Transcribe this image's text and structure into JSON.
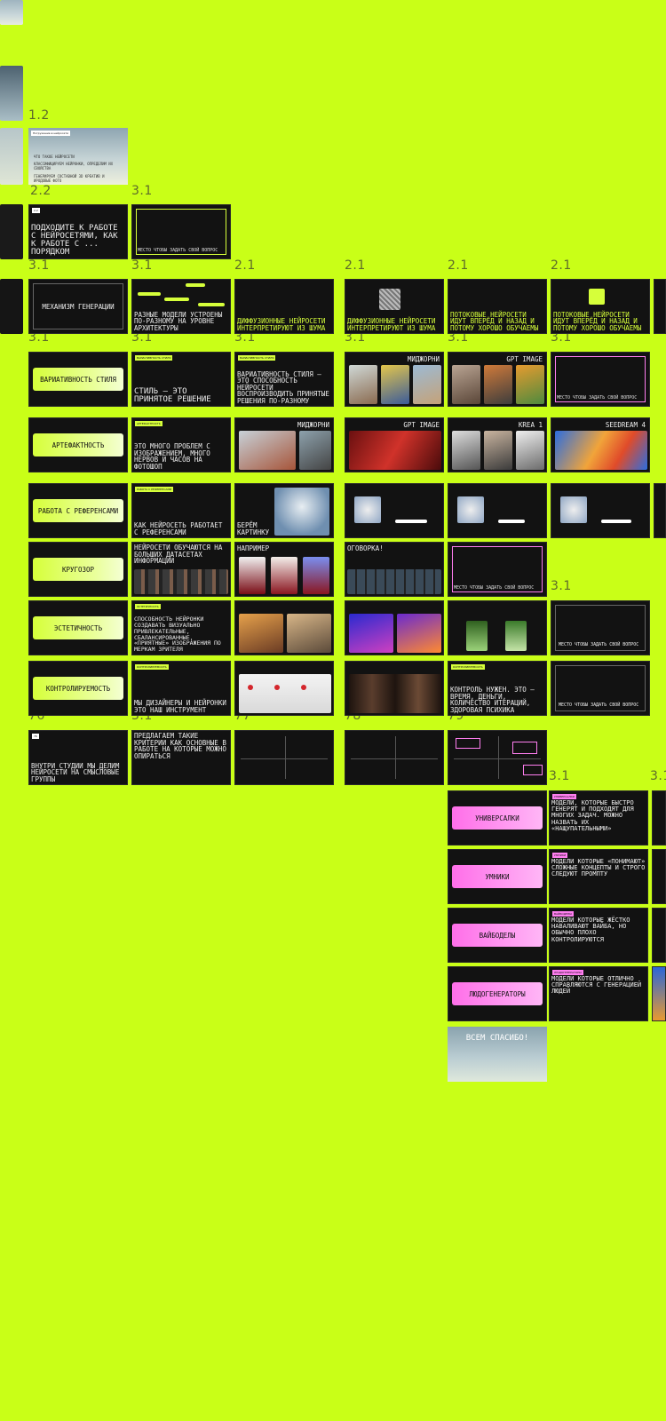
{
  "section_labels": {
    "s12": "1.2",
    "s22": "2.2",
    "s31": "3.1",
    "s21": "2.1",
    "s76": "76",
    "s77": "77",
    "s78": "78",
    "s79": "79"
  },
  "slides": {
    "intro_tag": "Погружение в нейросети",
    "intro_bullets": [
      "ЧТО ТАКОЕ НЕЙРОСЕТИ",
      "КЛАССИФИЦИРУЕМ НЕЙРОНКИ, ОПРЕДЕЛИМ ИХ СВОЙСТВА",
      "ГЕНЕРИРУЕМ СОСТАВНОЙ 3D КРЕАТИВ И ИРОДОВЫЕ ФОТО"
    ],
    "approach": "ПОДХОДИТЕ К РАБОТЕ С НЕЙРОСЕТЯМИ, КАК К РАБОТЕ С ... ПОРЯДКОМ",
    "question_place": "МЕСТО ЧТОБЫ ЗАДАТЬ СВОЙ ВОПРОС",
    "mechanism": "МЕХАНИЗМ ГЕНЕРАЦИИ",
    "diff_models": "РАЗНЫЕ МОДЕЛИ УСТРОЕНЫ ПО-РАЗНОМУ НА УРОВНЕ АРХИТЕКТУРЫ",
    "diffusion_1": "ДИФФУЗИОННЫЕ НЕЙРОСЕТИ ИНТЕРПРЕТИРУЮТ ИЗ ШУМА",
    "diffusion_2": "ДИФФУЗИОННЫЕ НЕЙРОСЕТИ ИНТЕРПРЕТИРУЮТ ИЗ ШУМА",
    "stream_1": "ПОТОКОВЫЕ НЕЙРОСЕТИ ИДУТ ВПЕРЁД И НАЗАД И ПОТОМУ ХОРОШО ОБУЧАЕМЫ",
    "stream_2": "ПОТОКОВЫЕ НЕЙРОСЕТИ ИДУТ ВПЕРЁД И НАЗАД И ПОТОМУ ХОРОШО ОБУЧАЕМЫ",
    "style_var": "ВАРИАТИВНОСТЬ СТИЛЯ",
    "style_is": "СТИЛЬ — ЭТО ПРИНЯТОЕ РЕШЕНИЕ",
    "style_def": "ВАРИАТИВНОСТЬ СТИЛЯ — ЭТО СПОСОБНОСТЬ НЕЙРОСЕТИ ВОСПРОИЗВОДИТЬ ПРИНЯТЫЕ РЕШЕНИЯ ПО-РАЗНОМУ",
    "midjourney": "МИДЖОРНИ",
    "gpt_image": "GPT IMAGE",
    "krea": "KREA 1",
    "seedream": "SEEDREAM 4",
    "artifacts": "АРТЕФАКТНОСТЬ",
    "artifacts_def": "ЭТО МНОГО ПРОБЛЕМ С ИЗОБРАЖЕНИЕМ, МНОГО НЕРВОВ И ЧАСОВ НА ФОТОШОП",
    "refs": "РАБОТА С РЕФЕРЕНСАМИ",
    "refs_def": "КАК НЕЙРОСЕТЬ РАБОТАЕТ С РЕФЕРЕНСАМИ",
    "take_pic": "БЕРЁМ КАРТИНКУ",
    "outlook": "КРУГОЗОР",
    "outlook_def": "НЕЙРОСЕТИ ОБУЧАЮТСЯ НА БОЛЬШИХ ДАТАСЕТАХ ИНФОРМАЦИИ",
    "example": "НАПРИМЕР",
    "caveat": "ОГОВОРКА!",
    "aesthetic": "ЭСТЕТИЧНОСТЬ",
    "aesthetic_def": "СПОСОБНОСТЬ НЕЙРОНКИ СОЗДАВАТЬ ВИЗУАЛЬНО ПРИВЛЕКАТЕЛЬНЫЕ, СБАЛАНСИРОВАННЫЕ, «ПРИЯТНЫЕ» ИЗОБРАЖЕНИЯ ПО МЕРКАМ ЗРИТЕЛЯ",
    "control": "КОНТРОЛИРУЕМОСТЬ",
    "control_def": "МЫ ДИЗАЙНЕРЫ И НЕЙРОНКИ ЭТО НАШ ИНСТРУМЕНТ",
    "control_need": "КОНТРОЛЬ НУЖЕН. ЭТО — ВРЕМЯ, ДЕНЬГИ, КОЛИЧЕСТВО ИТЕРАЦИЙ, ЗДОРОВАЯ ПСИХИКА",
    "studio": "ВНУТРИ СТУДИИ МЫ ДЕЛИМ НЕЙРОСЕТИ НА СМЫСЛОВЫЕ ГРУППЫ",
    "propose": "ПРЕДЛАГАЕМ ТАКИЕ КРИТЕРИИ КАК ОСНОВНЫЕ В РАБОТЕ НА КОТОРЫЕ МОЖНО ОПИРАТЬСЯ",
    "universal": "УНИВЕРСАЛКИ",
    "universal_def": "МОДЕЛИ, КОТОРЫЕ БЫСТРО ГЕНЕРЯТ И ПОДХОДЯТ ДЛЯ МНОГИХ ЗАДАЧ. МОЖНО НАЗВАТЬ ИХ «НАЩУПАТЕЛЬНЫМИ»",
    "smart": "УМНИКИ",
    "smart_def": "МОДЕЛИ КОТОРЫЕ «ПОНИМАЮТ» СЛОЖНЫЕ КОНЦЕПТЫ И СТРОГО СЛЕДУЮТ ПРОМПТУ",
    "vibe": "ВАЙБОДЕЛЫ",
    "vibe_def": "МОДЕЛИ КОТОРЫЕ ЖЁСТКО НАВАЛИВАЮТ ВАЙБА, НО ОБЫЧНО ПЛОХО КОНТРОЛИРУЮТСЯ",
    "people": "ЛЮДОГЕНЕРАТОРЫ",
    "people_def": "МОДЕЛИ КОТОРЫЕ ОТЛИЧНО СПРАВЛЯЮТСЯ С ГЕНЕРАЦИЕЙ ЛЮДЕЙ",
    "thanks": "ВСЕМ СПАСИБО!"
  },
  "colors": {
    "background": "#c9ff17",
    "slide": "#121212",
    "accent_yellow": "#d6ff3a",
    "accent_pink": "#ff7ef0"
  }
}
